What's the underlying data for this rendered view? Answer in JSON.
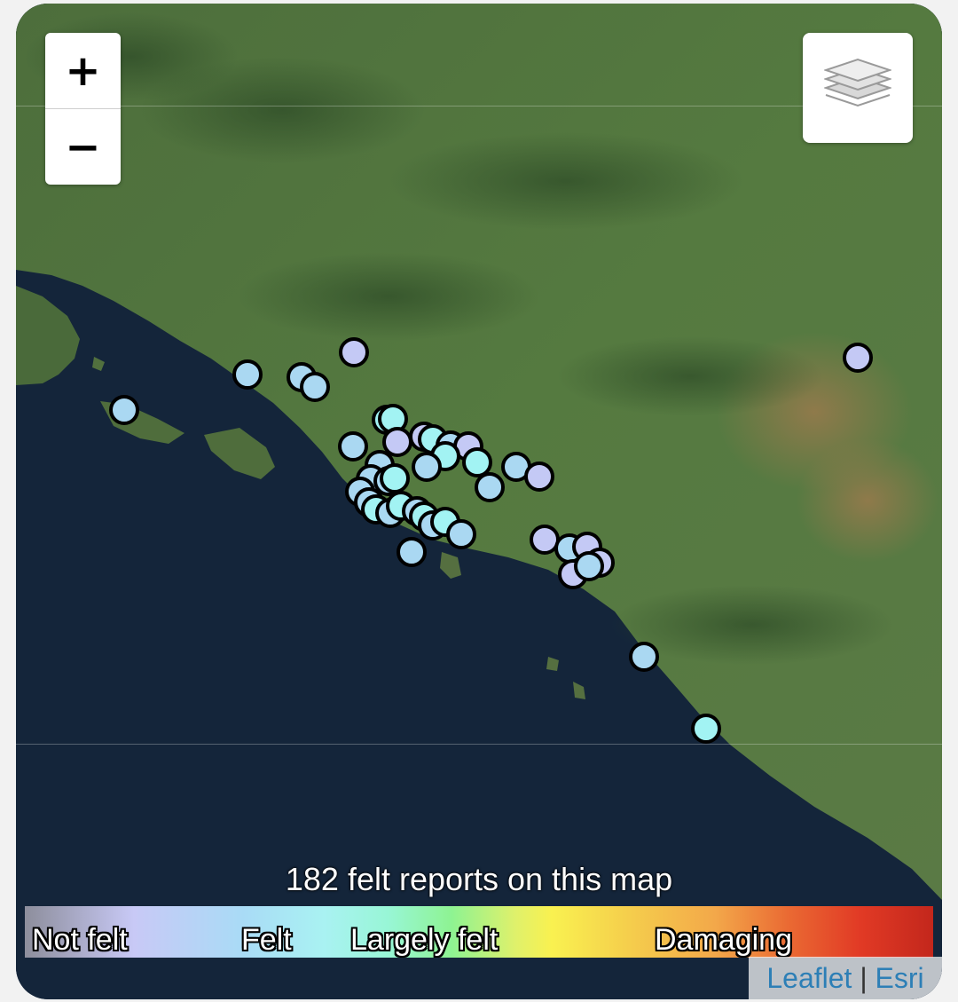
{
  "map": {
    "summary": "182 felt reports on this map",
    "zoom": {
      "in_label": "+",
      "out_label": "−"
    },
    "icons": {
      "layers": "layers-icon"
    },
    "legend": {
      "labels": [
        "Not felt",
        "Felt",
        "Largely felt",
        "Damaging"
      ]
    },
    "attribution": {
      "leaflet": "Leaflet",
      "separator": "|",
      "esri": "Esri"
    },
    "colors": {
      "sea": "#14253a",
      "land": "#4a6b3a",
      "marker_stroke": "#000000",
      "not_felt_marker": "#c4c9f5",
      "felt_marker": "#aad8f2",
      "largely_felt_marker": "#a2f3f3",
      "link": "#2d7fb6"
    }
  }
}
